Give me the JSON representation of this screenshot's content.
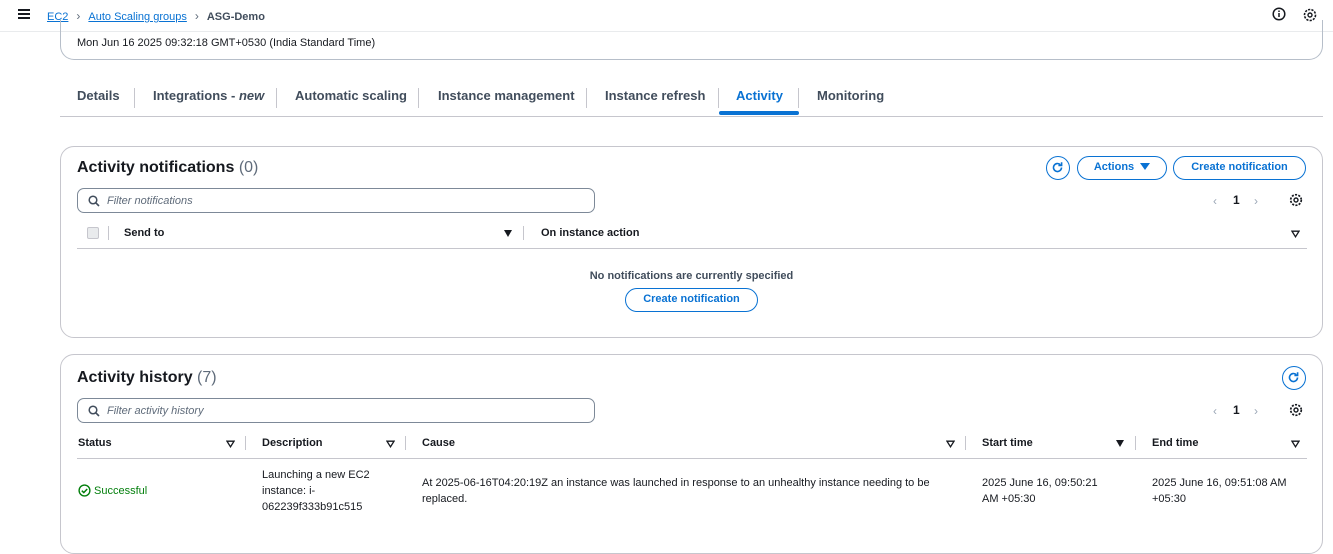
{
  "breadcrumbs": [
    "EC2",
    "Auto Scaling groups",
    "ASG-Demo"
  ],
  "summary": {
    "date": "Mon Jun 16 2025 09:32:18 GMT+0530 (India Standard Time)"
  },
  "tabs": {
    "details": "Details",
    "integrations": "Integrations - ",
    "integrations_badge": "new",
    "automatic_scaling": "Automatic scaling",
    "instance_management": "Instance management",
    "instance_refresh": "Instance refresh",
    "activity": "Activity",
    "monitoring": "Monitoring"
  },
  "notifications": {
    "title": "Activity notifications",
    "count": "(0)",
    "actions_label": "Actions",
    "create_label": "Create notification",
    "filter_placeholder": "Filter notifications",
    "page": "1",
    "columns": [
      "Send to",
      "On instance action"
    ],
    "empty_text": "No notifications are currently specified",
    "empty_create_label": "Create notification"
  },
  "history": {
    "title": "Activity history",
    "count": "(7)",
    "filter_placeholder": "Filter activity history",
    "page": "1",
    "columns": [
      "Status",
      "Description",
      "Cause",
      "Start time",
      "End time"
    ],
    "rows": [
      {
        "status": "Successful",
        "description": "Launching a new EC2 instance: i-062239f333b91c515",
        "cause": "At 2025-06-16T04:20:19Z an instance was launched in response to an unhealthy instance needing to be replaced.",
        "start_time": "2025 June 16, 09:50:21 AM +05:30",
        "end_time": "2025 June 16, 09:51:08 AM +05:30"
      }
    ]
  },
  "colors": {
    "accent": "#0972d3",
    "success": "#037f0c",
    "border": "#c6c6cd"
  }
}
